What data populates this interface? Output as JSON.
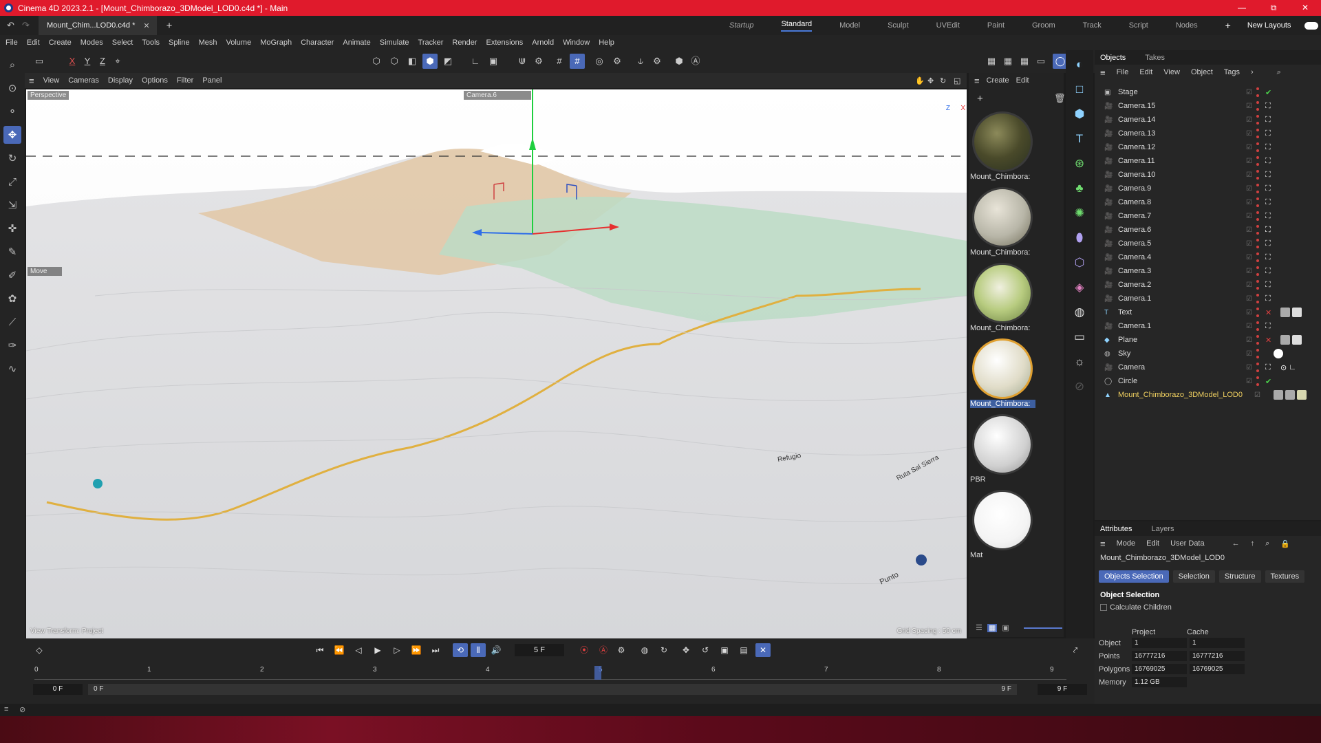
{
  "window": {
    "title": "Cinema 4D 2023.2.1 - [Mount_Chimborazo_3DModel_LOD0.c4d *] - Main",
    "controls": [
      "—",
      "⧉",
      "✕"
    ]
  },
  "doc_tab": {
    "label": "Mount_Chim...LOD0.c4d *",
    "close": "✕",
    "add": "+"
  },
  "layouts": {
    "items": [
      "Startup",
      "Standard",
      "Model",
      "Sculpt",
      "UVEdit",
      "Paint",
      "Groom",
      "Track",
      "Script",
      "Nodes"
    ],
    "add": "+",
    "new_layouts": "New Layouts"
  },
  "menu": [
    "File",
    "Edit",
    "Create",
    "Modes",
    "Select",
    "Tools",
    "Spline",
    "Mesh",
    "Volume",
    "MoGraph",
    "Character",
    "Animate",
    "Simulate",
    "Tracker",
    "Render",
    "Extensions",
    "Arnold",
    "Window",
    "Help"
  ],
  "axes": {
    "x": "X",
    "y": "Y",
    "z": "Z"
  },
  "viewport": {
    "menu": [
      "View",
      "Cameras",
      "Display",
      "Options",
      "Filter",
      "Panel"
    ],
    "label": "Perspective",
    "camera": "Camera.6",
    "move": "Move",
    "bottom_left": "View Transform: Project",
    "bottom_right": "Grid Spacing : 50 cm",
    "map_labels": [
      "Punto",
      "Ruta Sal Sierra",
      "Refugio"
    ]
  },
  "materials": {
    "menu": [
      "Create",
      "Edit"
    ],
    "items": [
      "Mount_Chimbora:",
      "Mount_Chimbora:",
      "Mount_Chimbora:",
      "Mount_Chimbora:",
      "PBR",
      "Mat"
    ]
  },
  "objects": {
    "tabs": [
      "Objects",
      "Takes"
    ],
    "menu": [
      "File",
      "Edit",
      "View",
      "Object",
      "Tags"
    ],
    "rows": [
      "Stage",
      "Camera.15",
      "Camera.14",
      "Camera.13",
      "Camera.12",
      "Camera.11",
      "Camera.10",
      "Camera.9",
      "Camera.8",
      "Camera.7",
      "Camera.6",
      "Camera.5",
      "Camera.4",
      "Camera.3",
      "Camera.2",
      "Camera.1",
      "Text",
      "Camera.1",
      "Plane",
      "Sky",
      "Camera",
      "Circle",
      "Mount_Chimborazo_3DModel_LOD0"
    ]
  },
  "attributes": {
    "tabs": [
      "Attributes",
      "Layers"
    ],
    "menu": [
      "Mode",
      "Edit",
      "User Data"
    ],
    "object_name": "Mount_Chimborazo_3DModel_LOD0",
    "subtabs": [
      "Objects Selection",
      "Selection",
      "Structure",
      "Textures"
    ],
    "section": "Object Selection",
    "calc_children": "Calculate Children",
    "col_project": "Project",
    "col_cache": "Cache",
    "rows": [
      {
        "label": "Object",
        "project": "1",
        "cache": "1"
      },
      {
        "label": "Points",
        "project": "16777216",
        "cache": "16777216"
      },
      {
        "label": "Polygons",
        "project": "16769025",
        "cache": "16769025"
      },
      {
        "label": "Memory",
        "project": "1.12 GB",
        "cache": ""
      }
    ]
  },
  "timeline": {
    "frame": "5 F",
    "ticks": [
      "0",
      "1",
      "2",
      "3",
      "4",
      "5",
      "6",
      "7",
      "8",
      "9"
    ],
    "start": "0 F",
    "start2": "0 F",
    "end": "9 F",
    "end2": "9 F"
  }
}
